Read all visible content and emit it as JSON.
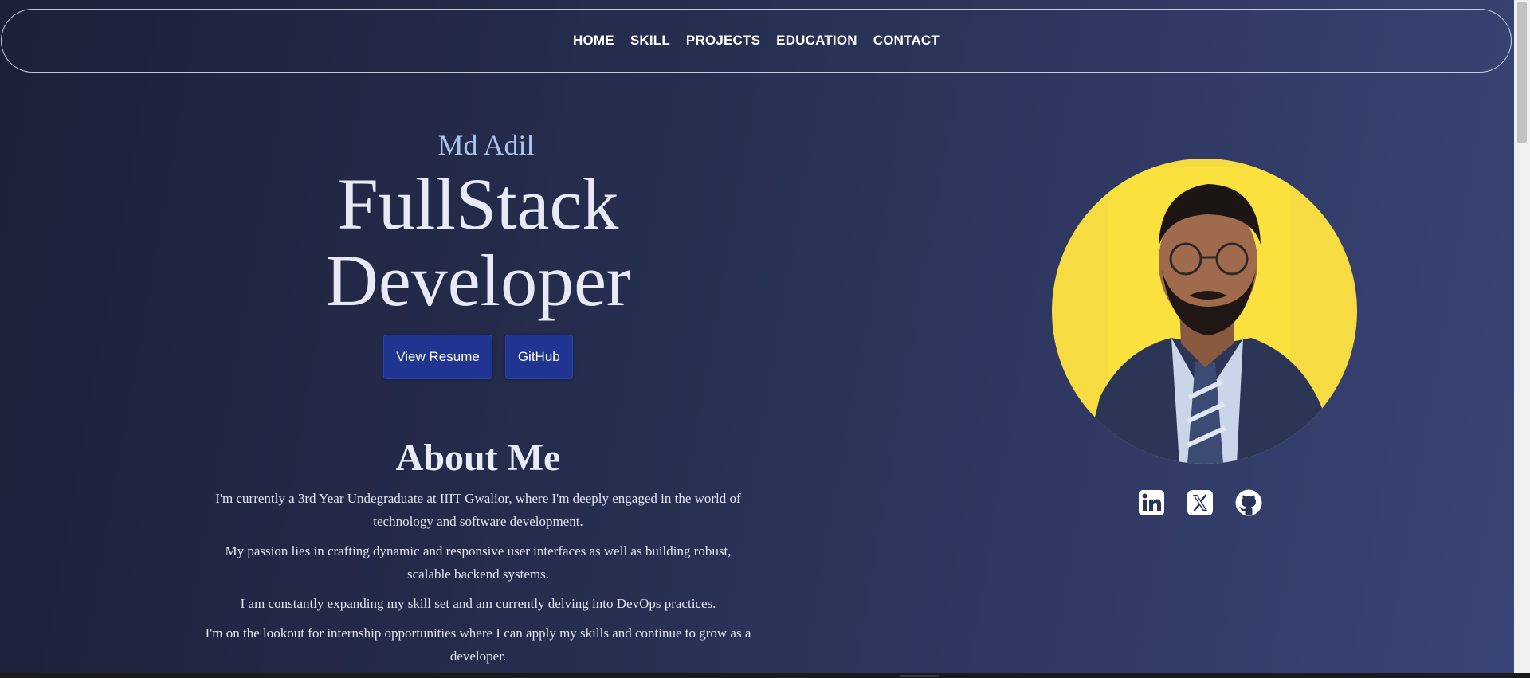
{
  "nav": {
    "items": [
      {
        "label": "HOME"
      },
      {
        "label": "SKILL"
      },
      {
        "label": "PROJECTS"
      },
      {
        "label": "EDUCATION"
      },
      {
        "label": "CONTACT"
      }
    ]
  },
  "hero": {
    "name": "Md Adil",
    "title_line1": "FullStack",
    "title_line2": "Developer",
    "buttons": {
      "resume": "View Resume",
      "github": "GitHub"
    }
  },
  "about": {
    "heading": "About Me",
    "paragraphs": [
      "I'm currently a 3rd Year Undegraduate at IIIT Gwalior, where I'm deeply engaged in the world of technology and software development.",
      "My passion lies in crafting dynamic and responsive user interfaces as well as building robust, scalable backend systems.",
      "I am constantly expanding my skill set and am currently delving into DevOps practices.",
      "I'm on the lookout for internship opportunities where I can apply my skills and continue to grow as a developer."
    ]
  },
  "socials": [
    {
      "icon": "linkedin-icon"
    },
    {
      "icon": "x-twitter-icon"
    },
    {
      "icon": "github-icon"
    }
  ],
  "colors": {
    "button_bg": "#1f3591",
    "photo_bg": "#f6dc42",
    "name_accent": "#a9c2ee"
  }
}
